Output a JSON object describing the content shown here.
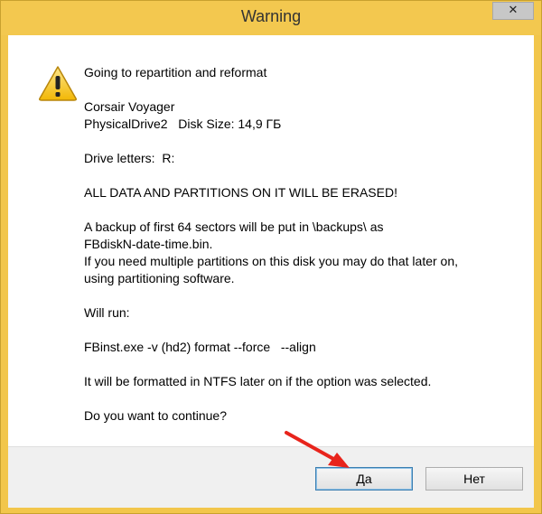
{
  "window": {
    "title": "Warning",
    "close_label": "✕"
  },
  "message": {
    "line1": "Going to repartition and reformat",
    "device_name": "Corsair Voyager",
    "device_info": "PhysicalDrive2   Disk Size: 14,9 ГБ",
    "drive_letters": "Drive letters:  R:",
    "erase_warning": "ALL DATA AND PARTITIONS ON IT WILL BE ERASED!",
    "backup_line1": "A backup of first 64 sectors will be put in \\backups\\ as",
    "backup_line2": "FBdiskN-date-time.bin.",
    "partition_line1": "If you need multiple partitions on this disk you may do that later on,",
    "partition_line2": "using partitioning software.",
    "will_run": "Will run:",
    "command": "FBinst.exe -v (hd2) format --force   --align",
    "ntfs_note": "It will be formatted in NTFS later on if the option was selected.",
    "question": "Do you want to continue?"
  },
  "buttons": {
    "yes_label": "Да",
    "no_label": "Нет"
  },
  "icons": {
    "warning": "warning-triangle-icon",
    "arrow": "red-arrow-annotation"
  },
  "colors": {
    "titlebar": "#f3c84f",
    "arrow": "#e8241c",
    "default_button_border": "#3c7fb1"
  }
}
